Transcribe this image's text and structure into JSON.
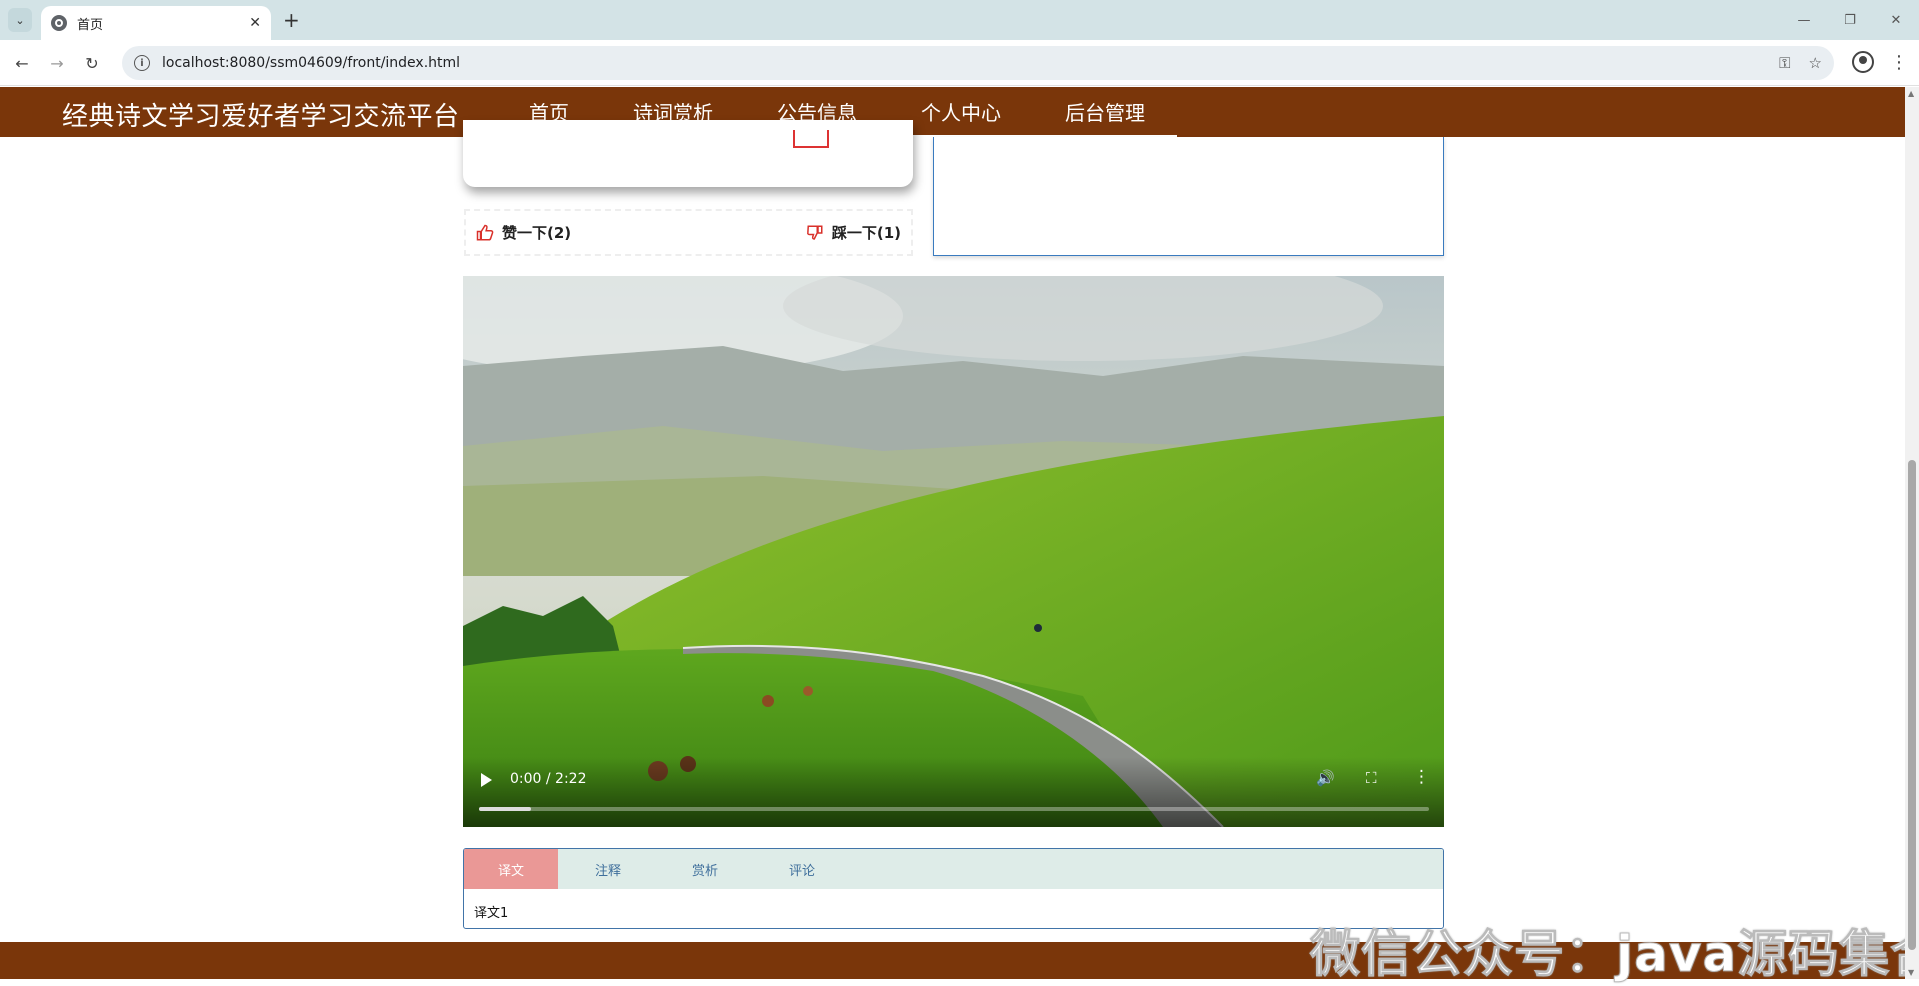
{
  "browser": {
    "tab_title": "首页",
    "url": "localhost:8080/ssm04609/front/index.html",
    "tab_menu_icon": "chevron-down-icon",
    "new_tab_label": "+",
    "close_label": "✕"
  },
  "site": {
    "brand": "经典诗文学习爱好者学习交流平台",
    "menu": [
      "首页",
      "诗词赏析",
      "公告信息",
      "个人中心",
      "后台管理"
    ]
  },
  "votes": {
    "like_label": "赞一下(2)",
    "dislike_label": "踩一下(1)",
    "accent": "#d9302a"
  },
  "video": {
    "time": "0:00 / 2:22",
    "buffered_fraction": 0.055
  },
  "detail_tabs": {
    "items": [
      "译文",
      "注释",
      "赏析",
      "评论"
    ],
    "active_index": 0,
    "content": "译文1"
  },
  "watermark": "微信公众号：java源码集合",
  "colors": {
    "header_bg": "#7a360a",
    "active_tab": "#ea9896",
    "tab_bar": "#deece8",
    "panel_border": "#4174a8"
  }
}
